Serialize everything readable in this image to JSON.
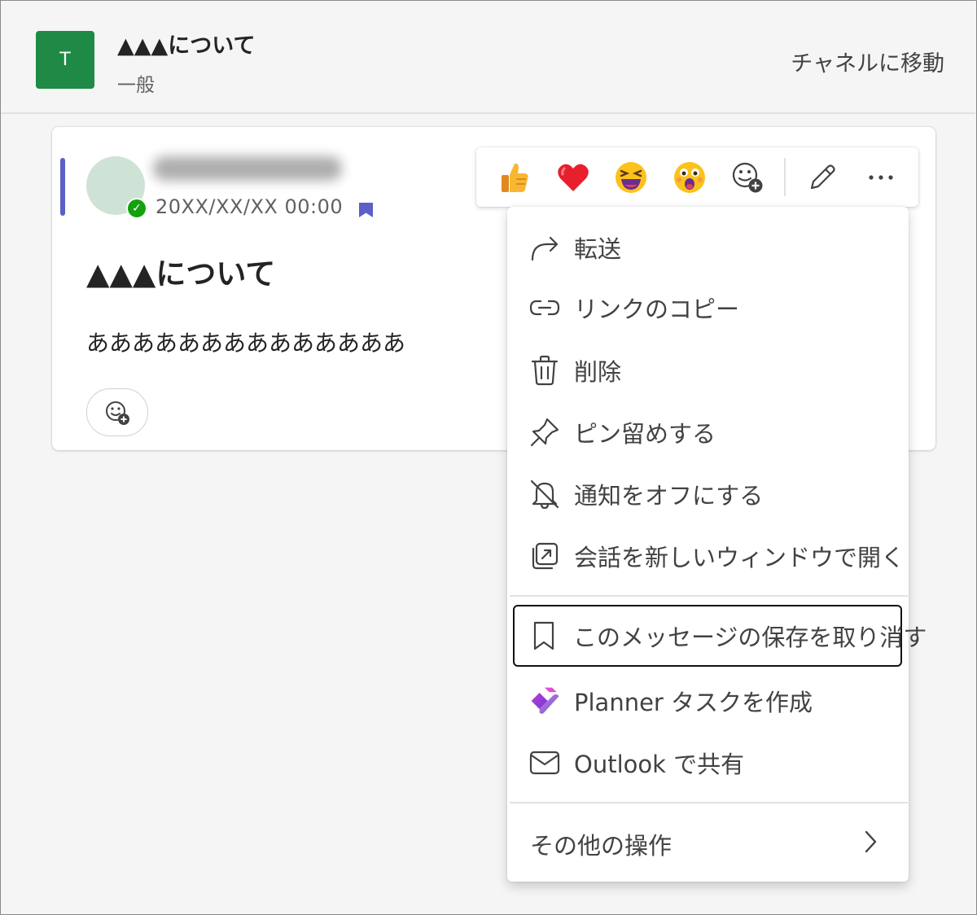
{
  "header": {
    "team_initial": "T",
    "thread_title": "▲▲▲について",
    "channel_name": "一般",
    "goto_channel_label": "チャネルに移動"
  },
  "message": {
    "timestamp": "20XX/XX/XX 00:00",
    "title": "▲▲▲について",
    "body": "ああああああああああああああ"
  },
  "reaction_bar": {
    "items": [
      {
        "icon": "thumbs-up-emoji-icon"
      },
      {
        "icon": "heart-emoji-icon"
      },
      {
        "icon": "laughing-emoji-icon"
      },
      {
        "icon": "surprised-emoji-icon"
      },
      {
        "icon": "add-reaction-icon"
      },
      {
        "icon": "edit-pencil-icon"
      },
      {
        "icon": "more-options-icon"
      }
    ]
  },
  "menu": {
    "items": [
      {
        "label": "転送",
        "icon": "forward-arrow-icon"
      },
      {
        "label": "リンクのコピー",
        "icon": "link-icon"
      },
      {
        "label": "削除",
        "icon": "trash-icon"
      },
      {
        "label": "ピン留めする",
        "icon": "pin-icon"
      },
      {
        "label": "通知をオフにする",
        "icon": "bell-off-icon"
      },
      {
        "label": "会話を新しいウィンドウで開く",
        "icon": "open-new-window-icon"
      },
      {
        "label": "このメッセージの保存を取り消す",
        "icon": "bookmark-icon"
      },
      {
        "label": "Planner タスクを作成",
        "icon": "planner-icon"
      },
      {
        "label": "Outlook で共有",
        "icon": "mail-icon"
      },
      {
        "label": "その他の操作",
        "icon": "chevron-right-icon"
      }
    ]
  },
  "colors": {
    "team_avatar": "#1e8a45",
    "accent": "#5b5fc7",
    "presence_available": "#13a10e"
  }
}
